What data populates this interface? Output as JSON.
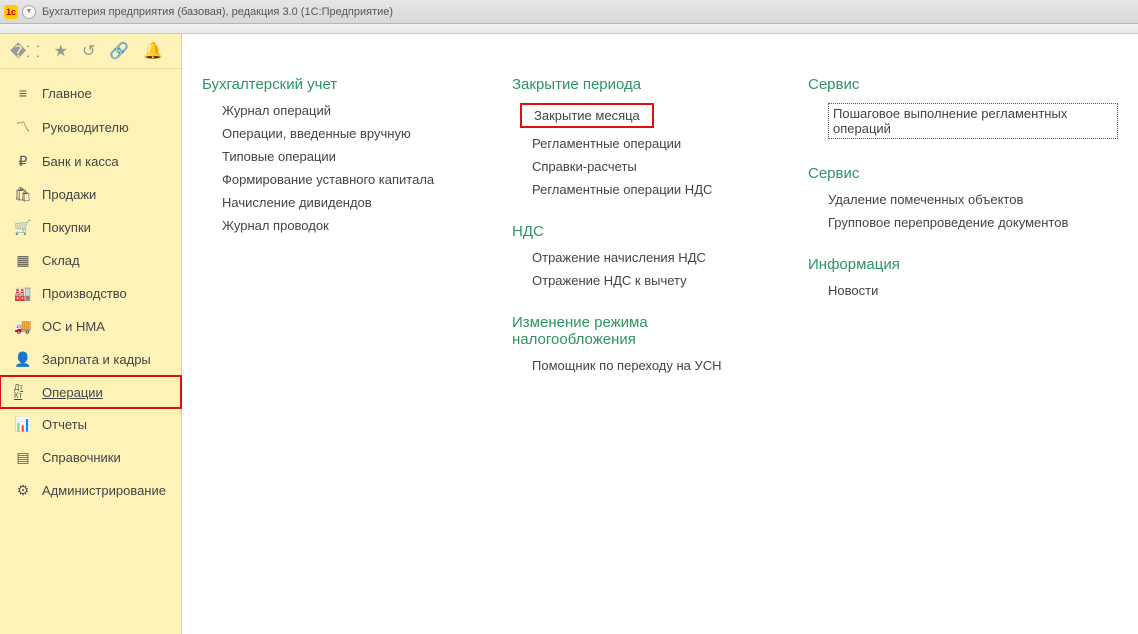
{
  "window": {
    "title": "Бухгалтерия предприятия (базовая), редакция 3.0  (1С:Предприятие)"
  },
  "sidebar": {
    "items": [
      {
        "label": "Главное"
      },
      {
        "label": "Руководителю"
      },
      {
        "label": "Банк и касса"
      },
      {
        "label": "Продажи"
      },
      {
        "label": "Покупки"
      },
      {
        "label": "Склад"
      },
      {
        "label": "Производство"
      },
      {
        "label": "ОС и НМА"
      },
      {
        "label": "Зарплата и кадры"
      },
      {
        "label": "Операции"
      },
      {
        "label": "Отчеты"
      },
      {
        "label": "Справочники"
      },
      {
        "label": "Администрирование"
      }
    ]
  },
  "content": {
    "col1": {
      "group1": {
        "title": "Бухгалтерский учет",
        "links": [
          "Журнал операций",
          "Операции, введенные вручную",
          "Типовые операции",
          "Формирование уставного капитала",
          "Начисление дивидендов",
          "Журнал проводок"
        ]
      }
    },
    "col2": {
      "group1": {
        "title": "Закрытие периода",
        "links": [
          "Закрытие месяца",
          "Регламентные операции",
          "Справки-расчеты",
          "Регламентные операции НДС"
        ]
      },
      "group2": {
        "title": "НДС",
        "links": [
          "Отражение начисления НДС",
          "Отражение НДС к вычету"
        ]
      },
      "group3": {
        "title": "Изменение режима налогообложения",
        "links": [
          "Помощник по переходу на УСН"
        ]
      }
    },
    "col3": {
      "group1": {
        "title": "Сервис",
        "links": [
          "Пошаговое выполнение регламентных операций"
        ]
      },
      "group2": {
        "title": "Сервис",
        "links": [
          "Удаление помеченных объектов",
          "Групповое перепроведение документов"
        ]
      },
      "group3": {
        "title": "Информация",
        "links": [
          "Новости"
        ]
      }
    }
  }
}
